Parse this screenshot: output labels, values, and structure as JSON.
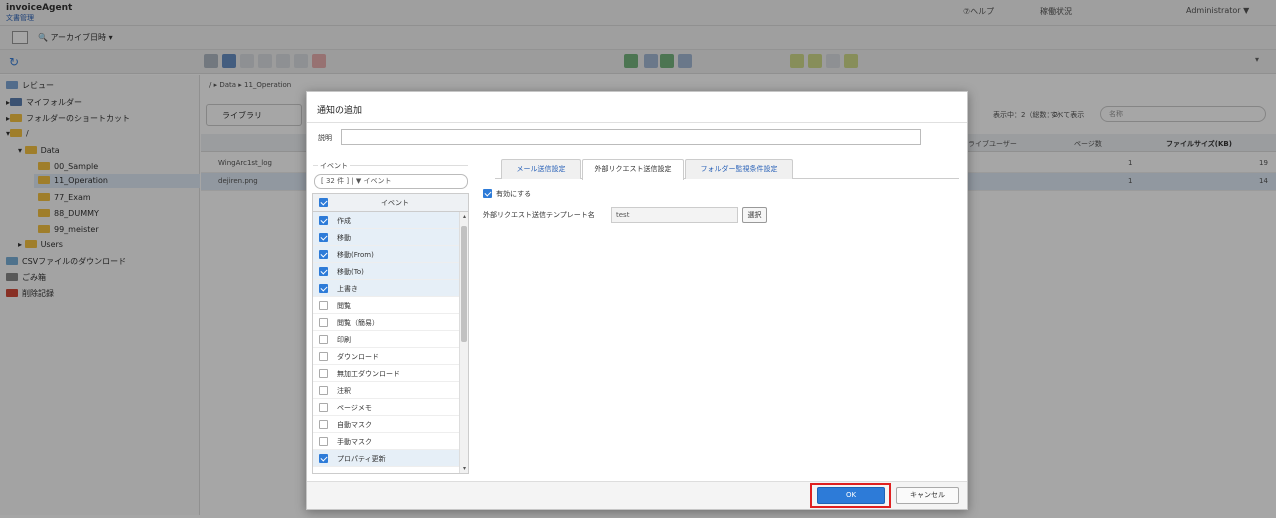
{
  "header": {
    "brand": "invoiceAgent",
    "brand_sub": "文書管理",
    "help": "⑦ヘルプ",
    "status": "稼働状況",
    "user": "Administrator ▼"
  },
  "subbar": {
    "archive_label": "アーカイブ日時 ▾"
  },
  "tree": {
    "items": [
      {
        "label": "レビュー"
      },
      {
        "label": "マイフォルダー"
      },
      {
        "label": "フォルダーのショートカット"
      },
      {
        "label": "/"
      },
      {
        "label": "Data"
      },
      {
        "label": "00_Sample"
      },
      {
        "label": "11_Operation"
      },
      {
        "label": "77_Exam"
      },
      {
        "label": "88_DUMMY"
      },
      {
        "label": "99_meister"
      },
      {
        "label": "Users"
      },
      {
        "label": "CSVファイルのダウンロード"
      },
      {
        "label": "ごみ箱"
      },
      {
        "label": "削除記録"
      }
    ]
  },
  "main": {
    "breadcrumb": "/ ▸ Data ▸ 11_Operation",
    "library_tab": "ライブラリ",
    "count": "表示中：2（総数：2）",
    "filter_all": "すべて表示",
    "filter_name": "名称",
    "columns": {
      "user": "ライブユーザー",
      "pages": "ページ数",
      "size": "ファイルサイズ(KB)"
    },
    "rows": [
      {
        "name": "WingArc1st_log",
        "pages": "1",
        "size": "19"
      },
      {
        "name": "dejiren.png",
        "pages": "1",
        "size": "14"
      }
    ]
  },
  "dialog": {
    "title": "通知の追加",
    "desc_label": "説明",
    "desc_value": "",
    "events_legend": "イベント",
    "events_filter": "[ 32 件 ] | ▼ イベント",
    "events_header": "イベント",
    "events": [
      {
        "label": "作成",
        "checked": true
      },
      {
        "label": "移動",
        "checked": true
      },
      {
        "label": "移動(From)",
        "checked": true
      },
      {
        "label": "移動(To)",
        "checked": true
      },
      {
        "label": "上書き",
        "checked": true
      },
      {
        "label": "閲覧",
        "checked": false
      },
      {
        "label": "閲覧（簡易）",
        "checked": false
      },
      {
        "label": "印刷",
        "checked": false
      },
      {
        "label": "ダウンロード",
        "checked": false
      },
      {
        "label": "無加工ダウンロード",
        "checked": false
      },
      {
        "label": "注釈",
        "checked": false
      },
      {
        "label": "ページメモ",
        "checked": false
      },
      {
        "label": "自動マスク",
        "checked": false
      },
      {
        "label": "手動マスク",
        "checked": false
      },
      {
        "label": "プロパティ更新",
        "checked": true
      }
    ],
    "tabs": [
      {
        "label": "メール送信設定",
        "active": false
      },
      {
        "label": "外部リクエスト送信設定",
        "active": true
      },
      {
        "label": "フォルダー監視条件設定",
        "active": false
      }
    ],
    "enable_label": "有効にする",
    "template_label": "外部リクエスト送信テンプレート名",
    "template_value": "test",
    "select_button": "選択",
    "ok": "OK",
    "cancel": "キャンセル"
  },
  "colors": {
    "accent": "#2d7bd8",
    "highlight": "#e02020",
    "selected_row": "#e6eff7"
  }
}
